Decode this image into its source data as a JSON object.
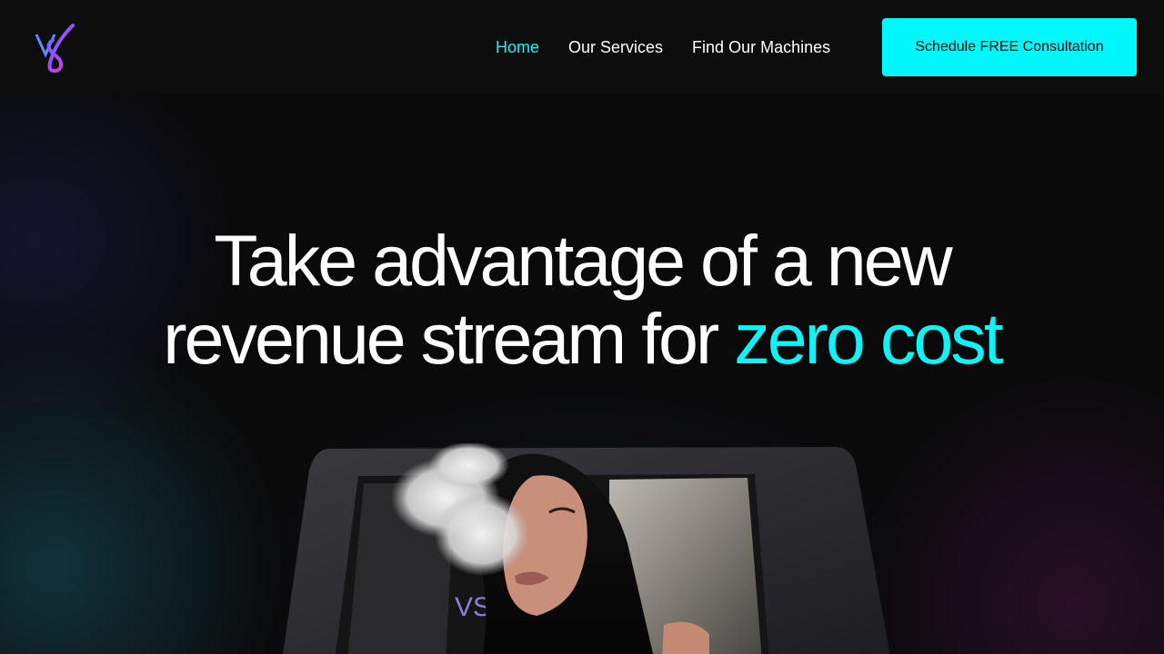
{
  "header": {
    "logo": "vs-logo",
    "nav": [
      {
        "label": "Home",
        "active": true
      },
      {
        "label": "Our Services",
        "active": false
      },
      {
        "label": "Find Our Machines",
        "active": false
      }
    ],
    "cta_label": "Schedule FREE Consultation"
  },
  "hero": {
    "headline_line1": "Take advantage of a new",
    "headline_line2_prefix": "revenue stream for ",
    "headline_line2_accent": "zero cost",
    "image": "woman-exhaling-vapor-in-front-of-vending-machine"
  },
  "colors": {
    "accent": "#00f7fb",
    "background": "#0a0a0b",
    "header_bg": "#0d0d0d"
  }
}
